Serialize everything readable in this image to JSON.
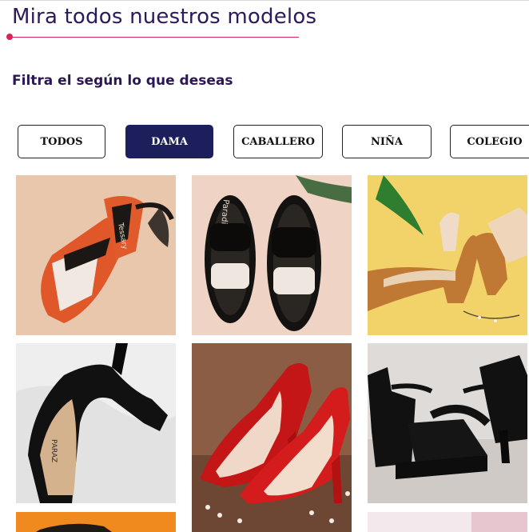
{
  "header": {
    "title": "Mira todos nuestros modelos",
    "filter_heading": "Filtra el según lo que deseas"
  },
  "filters": [
    {
      "label": "TODOS",
      "active": false
    },
    {
      "label": "DAMA",
      "active": true
    },
    {
      "label": "CABALLERO",
      "active": false
    },
    {
      "label": "NIÑA",
      "active": false
    },
    {
      "label": "COLEGIO",
      "active": false
    }
  ],
  "colors": {
    "title": "#2d1a5c",
    "accent": "#d9245a",
    "active_filter": "#1c1f5c"
  },
  "products": [
    {
      "name": "orange-black-white-sandal",
      "label": "Tessary"
    },
    {
      "name": "black-white-braided-slide",
      "label": "Paradi"
    },
    {
      "name": "tan-platform-block-heel"
    },
    {
      "name": "black-pump-heel",
      "label": "PARAZ"
    },
    {
      "name": "red-patent-pump"
    },
    {
      "name": "black-strappy-platform-heel"
    },
    {
      "name": "orange-tile-partial"
    },
    {
      "name": "white-tile-partial"
    },
    {
      "name": "pink-tile-partial"
    }
  ]
}
